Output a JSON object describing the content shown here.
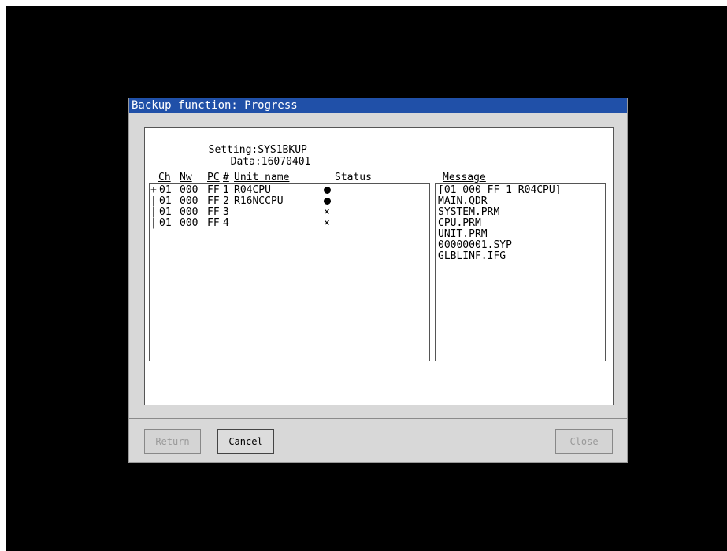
{
  "dialog": {
    "title": "Backup function: Progress"
  },
  "info": {
    "setting_label": "Setting:",
    "setting_value": "SYS1BKUP",
    "data_label": "Data:",
    "data_value": "16070401"
  },
  "unit_table": {
    "headers": {
      "ch": "Ch",
      "nw": "Nw",
      "pc": "PC",
      "num": "#",
      "unit_name": "Unit name",
      "status": "Status"
    },
    "rows": [
      {
        "tree": "+",
        "ch": "01",
        "nw": "000",
        "pc": "FF",
        "num": "1",
        "unit_name": "R04CPU",
        "status": "dot"
      },
      {
        "tree": "|",
        "ch": "01",
        "nw": "000",
        "pc": "FF",
        "num": "2",
        "unit_name": "R16NCCPU",
        "status": "dot"
      },
      {
        "tree": "|",
        "ch": "01",
        "nw": "000",
        "pc": "FF",
        "num": "3",
        "unit_name": "",
        "status": "cross"
      },
      {
        "tree": "|",
        "ch": "01",
        "nw": "000",
        "pc": "FF",
        "num": "4",
        "unit_name": "",
        "status": "cross"
      }
    ],
    "cross_glyph": "×"
  },
  "messages": {
    "header": "Message",
    "lines": [
      "[01 000 FF 1 R04CPU]",
      "MAIN.QDR",
      "SYSTEM.PRM",
      "CPU.PRM",
      "UNIT.PRM",
      "00000001.SYP",
      "GLBLINF.IFG"
    ]
  },
  "buttons": {
    "return_label": "Return",
    "cancel_label": "Cancel",
    "close_label": "Close"
  },
  "colors": {
    "titlebar": "#2050a8",
    "dialog_bg": "#d8d8d8",
    "screen_bg": "#000000"
  }
}
